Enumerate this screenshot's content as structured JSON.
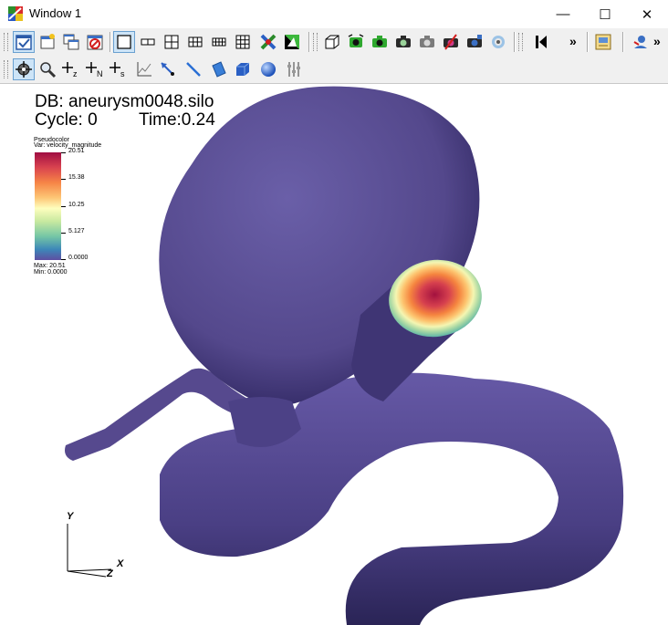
{
  "window": {
    "title": "Window 1",
    "minimize_glyph": "—",
    "maximize_glyph": "☐",
    "close_glyph": "✕"
  },
  "toolbar_top": {
    "buttons": [
      "active-window-icon",
      "new-window-icon",
      "clone-window-icon",
      "delete-window-icon",
      "layout-1x1-icon",
      "layout-1x2-icon",
      "layout-2x2-icon",
      "layout-2x3-icon",
      "layout-3x3-icon",
      "layout-4x4-icon",
      "lock-view-icon",
      "invert-background-icon",
      "bbox-mode-icon",
      "spin-icon",
      "camera-icon",
      "camera-save-icon",
      "camera-view-icon",
      "recenter-view-icon",
      "undo-view-icon",
      "reset-view-icon",
      "fullscreen-icon",
      "stop-animation-icon",
      "more-icon",
      "copy-window-icon",
      "set-view-icon",
      "more-icon"
    ],
    "overflow_label": "»"
  },
  "toolbar_bottom": {
    "buttons": [
      "navigate-mode-icon",
      "zoom-mode-icon",
      "pick-zone-icon",
      "pick-node-icon",
      "pick-s-icon",
      "lineout-icon",
      "point-tool-icon",
      "line-tool-icon",
      "plane-tool-icon",
      "box-tool-icon",
      "sphere-tool-icon",
      "axis-tool-icon"
    ],
    "pick_labels": [
      "+z",
      "+N",
      "+s"
    ]
  },
  "viewport": {
    "db": "DB: aneurysm0048.silo",
    "cycle": "Cycle: 0",
    "time": "Time:0.24",
    "legend": {
      "plot_type": "Pseudocolor",
      "variable": "Var: velocity_magnitude",
      "ticks": [
        "20.51",
        "15.38",
        "10.25",
        "5.127",
        "0.0000"
      ],
      "max": "Max: 20.51",
      "min": "Min: 0.0000",
      "colors": [
        "#a00d42",
        "#d9434f",
        "#f68446",
        "#fdc575",
        "#fefebe",
        "#c8e9a0",
        "#75c6a5",
        "#3d88b8",
        "#5e4fa2"
      ]
    },
    "triad": {
      "x": "X",
      "y": "Y",
      "z": "Z"
    },
    "surface_color": "#5a4e94",
    "background": "#ffffff"
  }
}
